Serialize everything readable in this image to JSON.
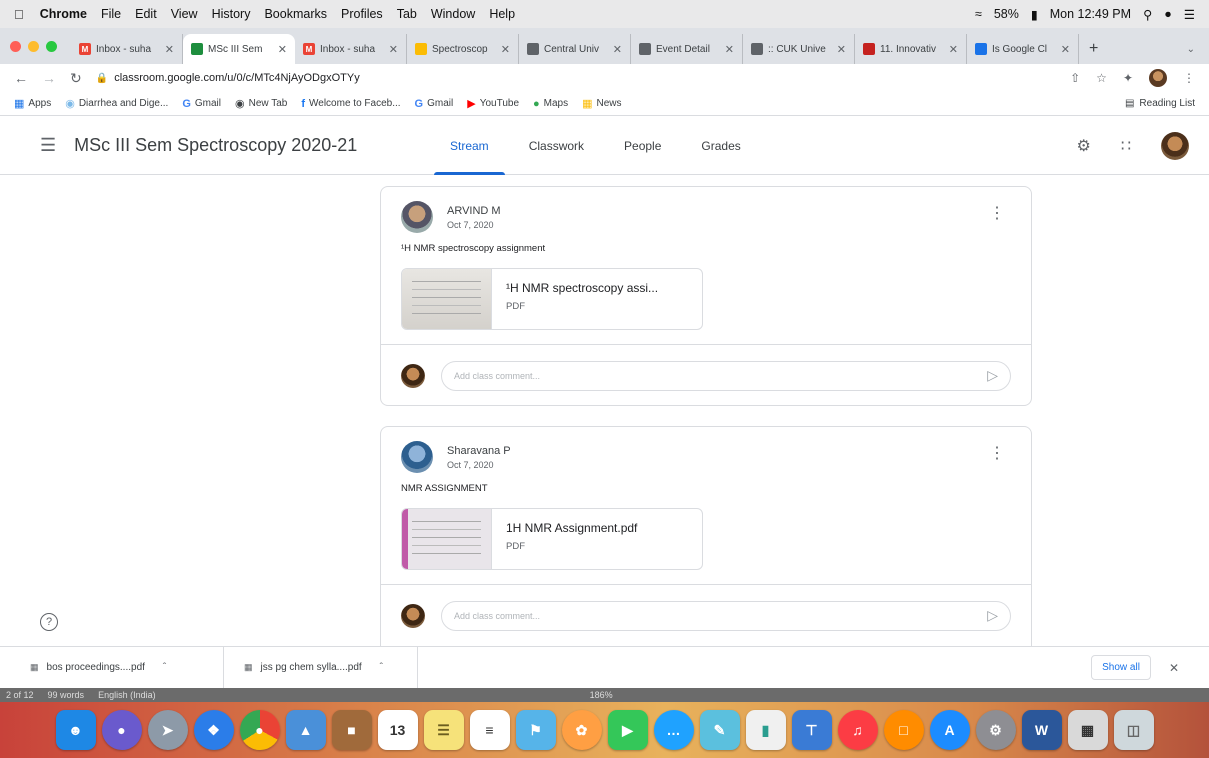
{
  "menubar": {
    "app": "Chrome",
    "items": [
      "File",
      "Edit",
      "View",
      "History",
      "Bookmarks",
      "Profiles",
      "Tab",
      "Window",
      "Help"
    ],
    "battery": "58%",
    "clock": "Mon 12:49 PM"
  },
  "tabs": [
    {
      "label": "Inbox - suha",
      "color": "#ea4335",
      "glyph": "M",
      "active": false
    },
    {
      "label": "MSc III Sem",
      "color": "#1e8e3e",
      "glyph": "",
      "active": true
    },
    {
      "label": "Inbox - suha",
      "color": "#ea4335",
      "glyph": "M",
      "active": false
    },
    {
      "label": "Spectroscop",
      "color": "#fbbc04",
      "glyph": "",
      "active": false
    },
    {
      "label": "Central Univ",
      "color": "#5f6368",
      "glyph": "",
      "active": false
    },
    {
      "label": "Event Detail",
      "color": "#5f6368",
      "glyph": "",
      "active": false
    },
    {
      "label": ":: CUK Unive",
      "color": "#5f6368",
      "glyph": "",
      "active": false
    },
    {
      "label": "11. Innovativ",
      "color": "#c5221f",
      "glyph": "",
      "active": false
    },
    {
      "label": "Is Google Cl",
      "color": "#1a73e8",
      "glyph": "",
      "active": false
    }
  ],
  "toolbar": {
    "url": "classroom.google.com/u/0/c/MTc4NjAyODgxOTYy"
  },
  "bookmarks": {
    "items": [
      "Apps",
      "Diarrhea and Dige...",
      "Gmail",
      "New Tab",
      "Welcome to Faceb...",
      "Gmail",
      "YouTube",
      "Maps",
      "News"
    ],
    "reading_list": "Reading List"
  },
  "classroom": {
    "title": "MSc III Sem Spectroscopy 2020-21",
    "nav": [
      "Stream",
      "Classwork",
      "People",
      "Grades"
    ]
  },
  "posts": [
    {
      "author": "ARVIND M",
      "date": "Oct 7, 2020",
      "text": "¹H NMR spectroscopy assignment",
      "attachment_name": "¹H NMR spectroscopy assi...",
      "attachment_type": "PDF",
      "comment_placeholder": "Add class comment..."
    },
    {
      "author": "Sharavana P",
      "date": "Oct 7, 2020",
      "text": "NMR ASSIGNMENT",
      "attachment_name": "1H NMR Assignment.pdf",
      "attachment_type": "PDF",
      "comment_placeholder": "Add class comment..."
    }
  ],
  "downloads": {
    "items": [
      "bos proceedings....pdf",
      "jss pg chem sylla....pdf"
    ],
    "show_all": "Show all"
  },
  "wordstatus": {
    "page": "2 of 12",
    "words": "99 words",
    "language": "English (India)",
    "zoom": "186%"
  },
  "dock": {
    "calendar_day": "13"
  }
}
